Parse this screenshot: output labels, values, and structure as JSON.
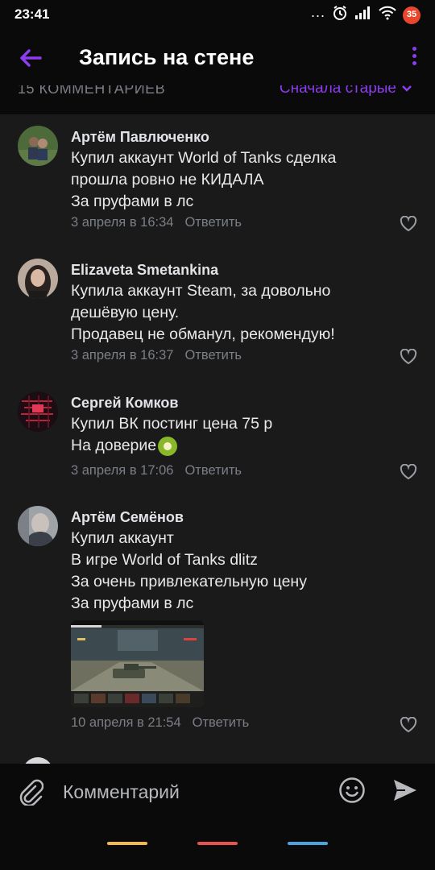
{
  "status_bar": {
    "time": "23:41",
    "dots": "...",
    "battery_level": "35",
    "icons": [
      "alarm-icon",
      "signal-icon",
      "wifi-icon"
    ]
  },
  "header": {
    "title": "Запись на стене",
    "back_icon": "back-arrow-icon",
    "menu_icon": "more-vertical-icon"
  },
  "sort": {
    "count_label": "15 КОММЕНТАРИЕВ",
    "order_label": "Сначала старые"
  },
  "comments": [
    {
      "author": "Артём Павлюченко",
      "text": "Купил аккаунт World of Tanks сделка\nпрошла ровно не КИДАЛА\nЗа пруфами в лс",
      "date": "3 апреля в 16:34",
      "reply": "Ответить"
    },
    {
      "author": "Elizaveta Smetankina",
      "text": "Купила аккаунт Steam, за довольно\nдешёвую цену.\nПродавец не обманул, рекомендую!",
      "date": "3 апреля в 16:37",
      "reply": "Ответить"
    },
    {
      "author": "Сергей Комков",
      "text_line1": "Купил ВК постинг цена 75 р",
      "text_line2": "На доверие",
      "emoji": "kiwi-emoji",
      "date": "3 апреля в 17:06",
      "reply": "Ответить"
    },
    {
      "author": "Артём Семёнов",
      "text": "Купил аккаунт\nВ игре World of Tanks dlitz\nЗа очень привлекательную цену\nЗа пруфами в лс",
      "attachment": "game-screenshot-thumbnail",
      "date": "10 апреля в 21:54",
      "reply": "Ответить"
    }
  ],
  "composer": {
    "placeholder": "Комментарий",
    "attach_icon": "paperclip-icon",
    "emoji_icon": "smile-icon",
    "send_icon": "send-icon"
  },
  "colors": {
    "accent": "#8d3cf0",
    "background": "#1a1a1b",
    "bars": "#0a0a0a",
    "nav_lines": [
      "#f2b84b",
      "#e8524f",
      "#4aa3df"
    ]
  }
}
